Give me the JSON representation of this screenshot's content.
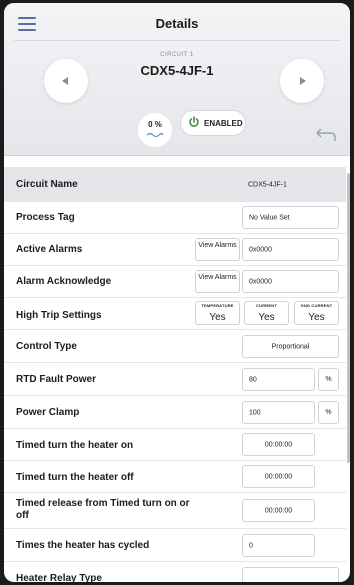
{
  "header": {
    "title": "Details",
    "circuit_label": "CIRCUIT 1",
    "circuit_name": "CDX5-4JF-1",
    "percent_label": "0 %",
    "enabled_label": "ENABLED"
  },
  "colors": {
    "accent": "#3f8f3f",
    "menu": "#5a6ea8",
    "row_highlight": "#e4e5e8"
  },
  "rows": {
    "circuit_name": {
      "label": "Circuit Name",
      "value": "CDX5-4JF-1"
    },
    "process_tag": {
      "label": "Process Tag",
      "value": "No Value Set"
    },
    "active_alarms": {
      "label": "Active Alarms",
      "button": "View Alarms",
      "value": "0x0000"
    },
    "alarm_ack": {
      "label": "Alarm Acknowledge",
      "button": "View Alarms",
      "value": "0x0000"
    },
    "high_trip": {
      "label": "High Trip Settings",
      "temperature": {
        "caption": "TEMPERATURE",
        "value": "Yes"
      },
      "current": {
        "caption": "CURRENT",
        "value": "Yes"
      },
      "gnd_current": {
        "caption": "GND CURRENT",
        "value": "Yes"
      }
    },
    "control_type": {
      "label": "Control Type",
      "value": "Proportional"
    },
    "rtd_fault_power": {
      "label": "RTD Fault Power",
      "value": "80",
      "unit": "%"
    },
    "power_clamp": {
      "label": "Power Clamp",
      "value": "100",
      "unit": "%"
    },
    "timed_on": {
      "label": "Timed turn the heater on",
      "value": "00:00:00"
    },
    "timed_off": {
      "label": "Timed turn the heater off",
      "value": "00:00:00"
    },
    "timed_release": {
      "label": "Timed release from Timed turn on or off",
      "value": "00:00:00"
    },
    "cycled": {
      "label": "Times the heater has cycled",
      "value": "0"
    },
    "relay_type": {
      "label": "Heater Relay Type",
      "value": ""
    }
  }
}
